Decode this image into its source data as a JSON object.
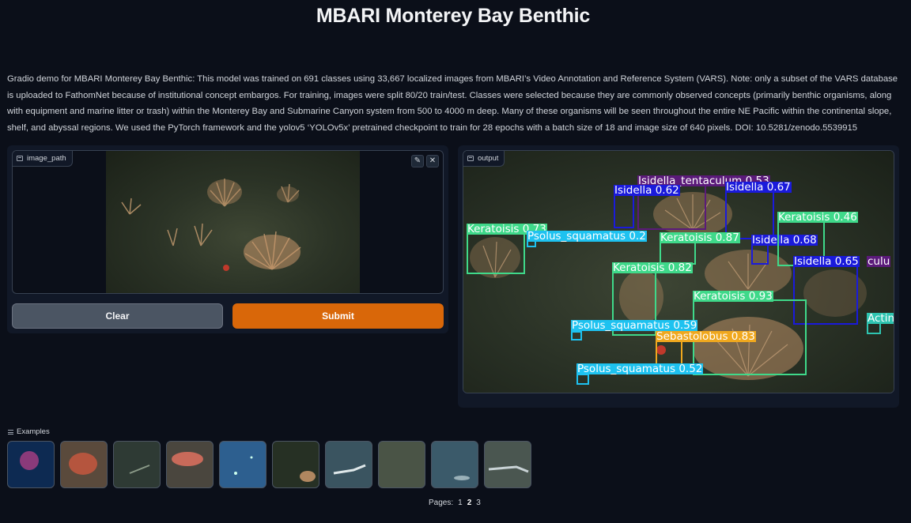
{
  "title": "MBARI Monterey Bay Benthic",
  "description": "Gradio demo for MBARI Monterey Bay Benthic: This model was trained on 691 classes using 33,667 localized images from MBARI’s Video Annotation and Reference System (VARS). Note: only a subset of the VARS database is uploaded to FathomNet because of institutional concept embargos. For training, images were split 80/20 train/test. Classes were selected because they are commonly observed concepts (primarily benthic organisms, along with equipment and marine litter or trash) within the Monterey Bay and Submarine Canyon system from 500 to 4000 m deep. Many of these organisms will be seen throughout the entire NE Pacific within the continental slope, shelf, and abyssal regions. We used the PyTorch framework and the yolov5 ‘YOLOv5x’ pretrained checkpoint to train for 28 epochs with a batch size of 18 and image size of 640 pixels. DOI: 10.5281/zenodo.5539915",
  "input": {
    "label": "image_path",
    "label_icon": "image-icon",
    "edit_icon": "pencil-icon",
    "close_icon": "close-icon"
  },
  "buttons": {
    "clear": "Clear",
    "submit": "Submit"
  },
  "output": {
    "label": "output",
    "label_icon": "image-icon",
    "detections": [
      {
        "text": "Isidella_tentaculum 0.53",
        "color": "#5b1a7a"
      },
      {
        "text": "Isidella 0.62",
        "color": "#1a1adb"
      },
      {
        "text": "Isidella 0.67",
        "color": "#1a1adb"
      },
      {
        "text": "Keratoisis 0.73",
        "color": "#3fd98a"
      },
      {
        "text": "Psolus_squamatus 0.2",
        "color": "#1ec2f0"
      },
      {
        "text": "Keratoisis 0.87",
        "color": "#3fd98a"
      },
      {
        "text": "Isidella 0.68",
        "color": "#1a1adb"
      },
      {
        "text": "Keratoisis 0.46",
        "color": "#3fd98a"
      },
      {
        "text": "Isidella 0.65",
        "color": "#1a1adb"
      },
      {
        "text": "Keratoisis 0.82",
        "color": "#3fd98a"
      },
      {
        "text": "Keratoisis 0.93",
        "color": "#3fd98a"
      },
      {
        "text": "Psolus_squamatus 0.59",
        "color": "#1ec2f0"
      },
      {
        "text": "Sebastolobus 0.83",
        "color": "#f0a81e"
      },
      {
        "text": "Psolus_squamatus 0.52",
        "color": "#1ec2f0"
      },
      {
        "text": "Actin",
        "color": "#2ec4b0"
      },
      {
        "text": "culu",
        "color": "#5b1a7a"
      }
    ]
  },
  "examples": {
    "title": "Examples",
    "title_icon": "list-icon",
    "thumbnail_colors": [
      "#0d2a52",
      "#5a4a3c",
      "#2e3a34",
      "#4a463e",
      "#2d5f8f",
      "#263024",
      "#3a5460",
      "#4a5446",
      "#3b5a6a",
      "#4a5650"
    ]
  },
  "pagination": {
    "label": "Pages:",
    "pages": [
      "1",
      "2",
      "3"
    ],
    "current": "2"
  },
  "colors": {
    "accent": "#d96709",
    "background": "#0b0f19",
    "panel": "#111827"
  }
}
